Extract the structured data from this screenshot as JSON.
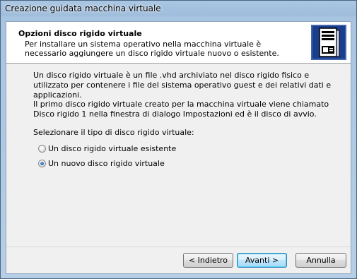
{
  "window": {
    "title": "Creazione guidata macchina virtuale"
  },
  "header": {
    "title": "Opzioni disco rigido virtuale",
    "subtitle": "Per installare un sistema operativo nella macchina virtuale è necessario aggiungere un disco rigido virtuale nuovo o esistente.",
    "icon": "server-tower-icon"
  },
  "body": {
    "paragraph1": "Un disco rigido virtuale è un file .vhd archiviato nel disco rigido fisico e utilizzato per contenere i file del sistema operativo guest e dei relativi dati e applicazioni.",
    "paragraph2": "Il primo disco rigido virtuale creato per la macchina virtuale viene chiamato Disco rigido 1 nella finestra di dialogo Impostazioni ed è il disco di avvio.",
    "prompt": "Selezionare il tipo di disco rigido virtuale:"
  },
  "options": [
    {
      "label": "Un disco rigido virtuale esistente",
      "selected": false
    },
    {
      "label": "Un nuovo disco rigido virtuale",
      "selected": true
    }
  ],
  "buttons": {
    "back": "< Indietro",
    "next": "Avanti >",
    "cancel": "Annulla"
  },
  "colors": {
    "accent": "#1d56a8",
    "frame": "#a9c6e3"
  }
}
